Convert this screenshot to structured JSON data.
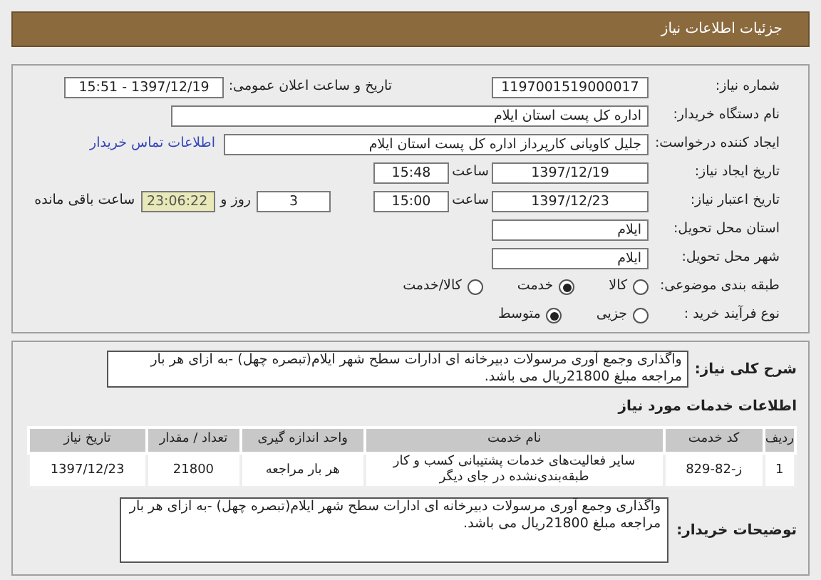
{
  "header": {
    "title": "جزئیات اطلاعات نیاز"
  },
  "need_number": {
    "label": "شماره نیاز:",
    "value": "1197001519000017"
  },
  "announce": {
    "label": "تاریخ و ساعت اعلان عمومی:",
    "value": "1397/12/19 - 15:51"
  },
  "buyer_org": {
    "label": "نام دستگاه خریدار:",
    "value": "اداره کل پست استان ایلام"
  },
  "requester": {
    "label": "ایجاد کننده درخواست:",
    "value": "جلیل کاویانی کارپرداز اداره کل پست استان ایلام",
    "link": "اطلاعات تماس خریدار"
  },
  "created": {
    "label": "تاریخ ایجاد نیاز:",
    "date": "1397/12/19",
    "time_label": "ساعت",
    "time": "15:48"
  },
  "validity": {
    "label": "تاریخ اعتبار نیاز:",
    "date": "1397/12/23",
    "time_label": "ساعت",
    "time": "15:00",
    "days": "3",
    "days_label": "روز و",
    "remaining": "23:06:22",
    "remaining_label": "ساعت باقی مانده"
  },
  "province": {
    "label": "استان محل تحویل:",
    "value": "ایلام"
  },
  "city": {
    "label": "شهر محل تحویل:",
    "value": "ایلام"
  },
  "category": {
    "label": "طبقه بندی موضوعی:",
    "options": [
      {
        "label": "کالا",
        "selected": false
      },
      {
        "label": "خدمت",
        "selected": true
      },
      {
        "label": "کالا/خدمت",
        "selected": false
      }
    ]
  },
  "process": {
    "label": "نوع فرآیند خرید :",
    "options": [
      {
        "label": "جزیی",
        "selected": false
      },
      {
        "label": "متوسط",
        "selected": true
      }
    ]
  },
  "summary": {
    "label": "شرح کلی نیاز:",
    "value": "واگذاری وجمع آوری مرسولات دبیرخانه ای ادارات سطح شهر ایلام(تبصره چهل) -به ازای هر بار مراجعه مبلغ 21800ریال می باشد."
  },
  "services_title": "اطلاعات خدمات مورد نیاز",
  "table": {
    "columns": [
      "ردیف",
      "کد خدمت",
      "نام خدمت",
      "واحد اندازه گیری",
      "تعداد / مقدار",
      "تاریخ نیاز"
    ],
    "rows": [
      [
        "1",
        "ز-82-829",
        "سایر فعالیت‌های خدمات پشتیبانی کسب و کار طبقه‌بندی‌نشده در جای دیگر",
        "هر بار مراجعه",
        "21800",
        "1397/12/23"
      ]
    ]
  },
  "buyer_notes": {
    "label": "توضیحات خریدار:",
    "value": "واگذاری وجمع آوری مرسولات دبیرخانه ای ادارات سطح شهر ایلام(تبصره چهل) -به ازای هر بار مراجعه مبلغ 21800ریال می باشد."
  }
}
